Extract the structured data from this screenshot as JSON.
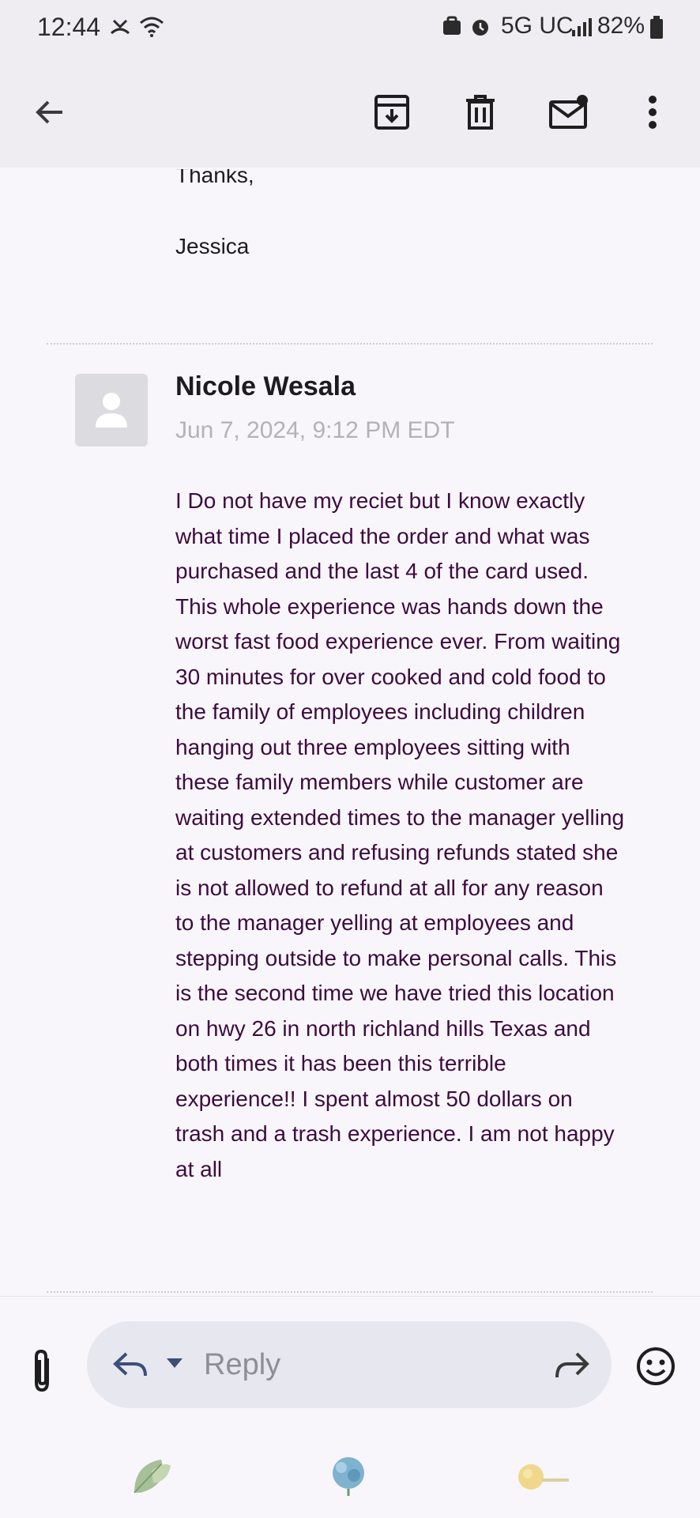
{
  "status_bar": {
    "time": "12:44",
    "network": "5G UC",
    "battery": "82%"
  },
  "toolbar": {
    "back_icon": "arrow-left-icon",
    "archive_icon": "archive-icon",
    "delete_icon": "trash-icon",
    "mark_unread_icon": "mail-unread-icon",
    "more_icon": "more-vert-icon"
  },
  "previous_message": {
    "closing": "Thanks,",
    "signature": "Jessica"
  },
  "message": {
    "sender": "Nicole Wesala",
    "date": "Jun 7, 2024, 9:12 PM EDT",
    "body_lines": [
      "I Do not have my reciet but I know exactly",
      "what time I placed the order and what was",
      "purchased  and the last 4 of the card used.",
      "This whole experience was hands down the",
      "worst fast food experience ever. From waiting",
      "30 minutes for over cooked and cold food to",
      "the family of employees including children",
      "hanging out three employees sitting with",
      "these family members while customer are",
      "waiting extended times to the manager yelling",
      "at customers and refusing refunds stated she",
      "is not allowed to refund at all for any reason",
      "to the manager yelling at employees and",
      "stepping outside to make personal calls. This",
      "is the second time we have tried this location",
      "on hwy 26 in north richland  hills Texas and",
      "both times it has been this terrible",
      "experience!! I spent almost 50 dollars on",
      "trash and a trash experience.  I am not happy",
      "at all"
    ]
  },
  "compose": {
    "reply_label": "Reply",
    "attach_icon": "paperclip-icon",
    "reply_icon": "reply-icon",
    "dropdown_icon": "caret-down-icon",
    "forward_icon": "forward-icon",
    "emoji_icon": "emoji-icon"
  },
  "colors": {
    "body_text": "#3d0b3f",
    "bar_bg": "#efedf2",
    "page_bg": "#f8f6fb",
    "reply_pill": "#e7e7ef"
  }
}
